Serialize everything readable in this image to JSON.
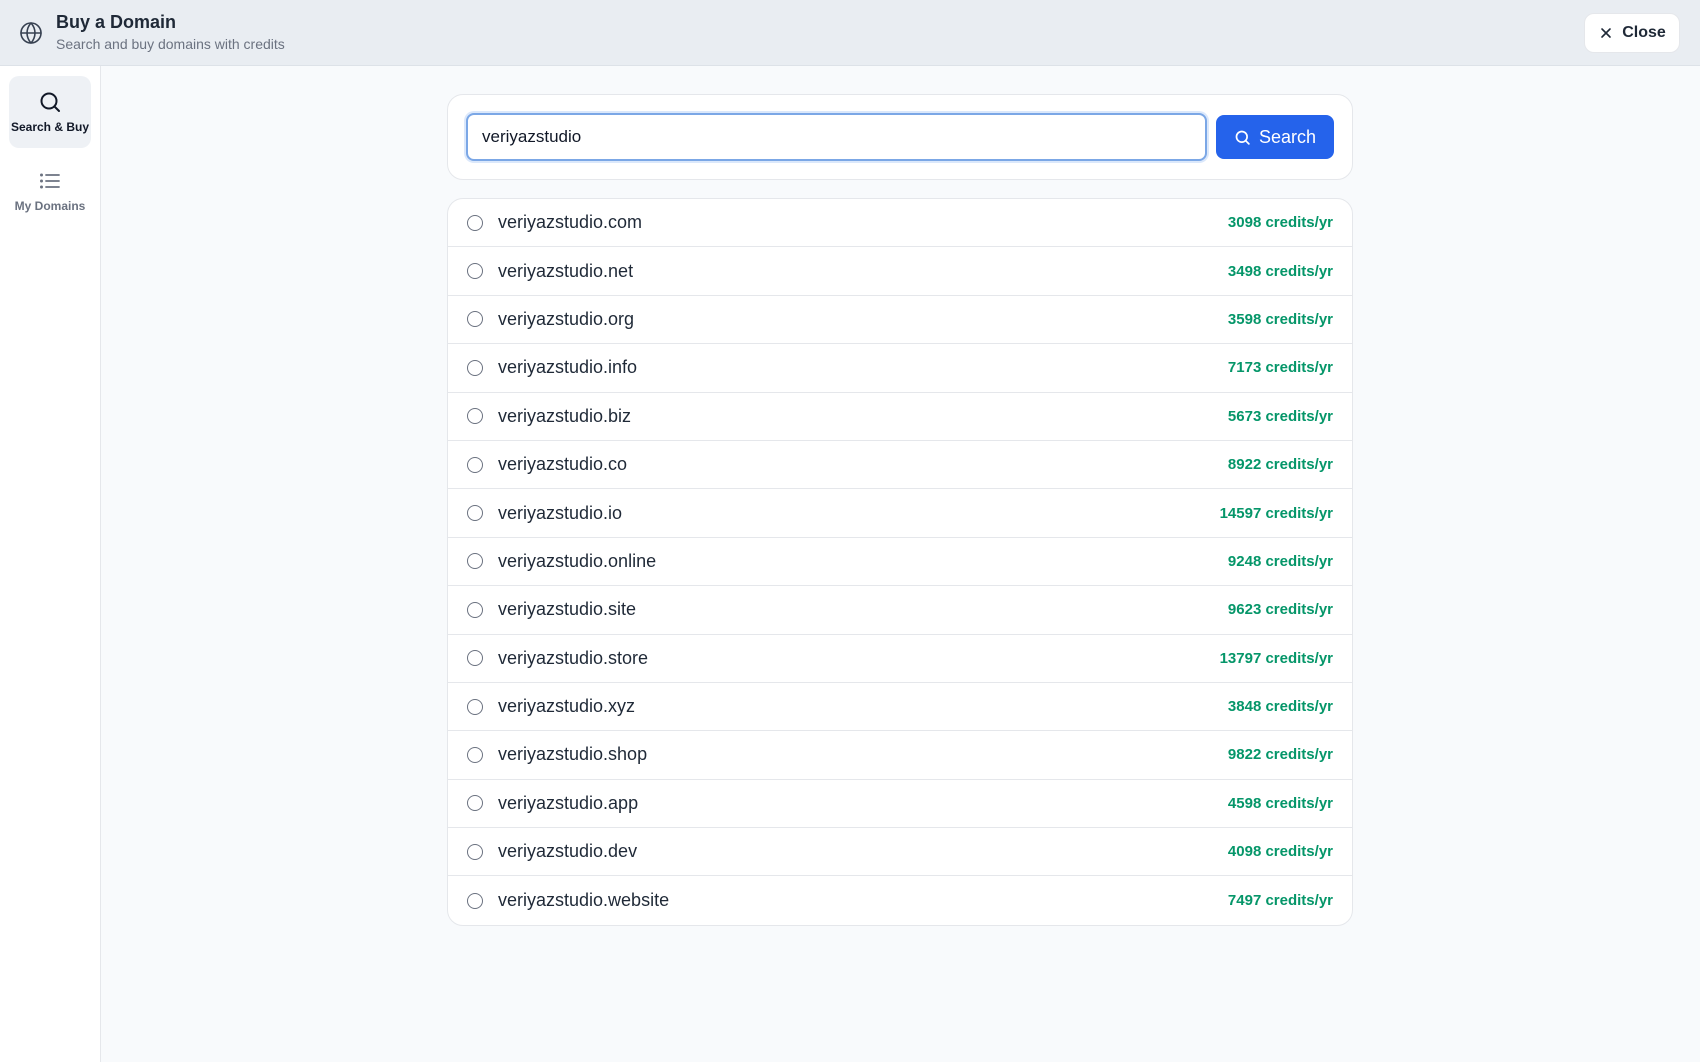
{
  "header": {
    "title": "Buy a Domain",
    "subtitle": "Search and buy domains with credits",
    "icon": "globe-icon",
    "close_label": "Close"
  },
  "sidebar": {
    "items": [
      {
        "label": "Search & Buy",
        "icon": "search-icon",
        "active": true
      },
      {
        "label": "My Domains",
        "icon": "list-icon",
        "active": false
      }
    ]
  },
  "search": {
    "value": "veriyazstudio",
    "button_label": "Search"
  },
  "results": [
    {
      "domain": "veriyazstudio.com",
      "price": "3098 credits/yr"
    },
    {
      "domain": "veriyazstudio.net",
      "price": "3498 credits/yr"
    },
    {
      "domain": "veriyazstudio.org",
      "price": "3598 credits/yr"
    },
    {
      "domain": "veriyazstudio.info",
      "price": "7173 credits/yr"
    },
    {
      "domain": "veriyazstudio.biz",
      "price": "5673 credits/yr"
    },
    {
      "domain": "veriyazstudio.co",
      "price": "8922 credits/yr"
    },
    {
      "domain": "veriyazstudio.io",
      "price": "14597 credits/yr"
    },
    {
      "domain": "veriyazstudio.online",
      "price": "9248 credits/yr"
    },
    {
      "domain": "veriyazstudio.site",
      "price": "9623 credits/yr"
    },
    {
      "domain": "veriyazstudio.store",
      "price": "13797 credits/yr"
    },
    {
      "domain": "veriyazstudio.xyz",
      "price": "3848 credits/yr"
    },
    {
      "domain": "veriyazstudio.shop",
      "price": "9822 credits/yr"
    },
    {
      "domain": "veriyazstudio.app",
      "price": "4598 credits/yr"
    },
    {
      "domain": "veriyazstudio.dev",
      "price": "4098 credits/yr"
    },
    {
      "domain": "veriyazstudio.website",
      "price": "7497 credits/yr"
    }
  ],
  "colors": {
    "accent": "#2563eb",
    "price": "#059669",
    "header_bg": "#e9edf2"
  }
}
